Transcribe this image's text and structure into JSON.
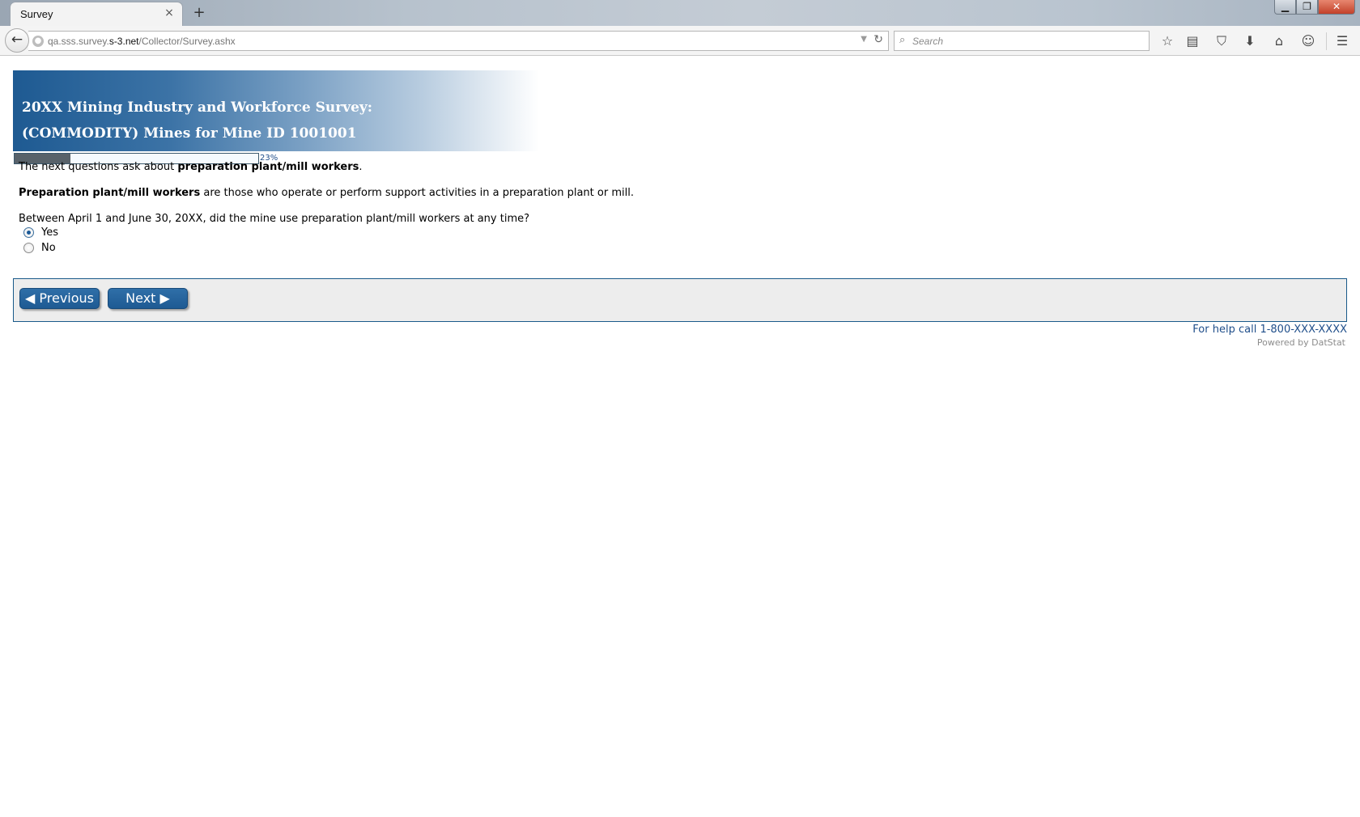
{
  "browser": {
    "tab_title": "Survey",
    "tab_close_glyph": "×",
    "new_tab_glyph": "+",
    "url_prefix": "qa.sss.survey.",
    "url_domain": "s-3.net",
    "url_path": "/Collector/Survey.ashx",
    "search_placeholder": "Search",
    "window_controls": {
      "minimize": "▁",
      "maximize": "❐",
      "close": "✕"
    },
    "toolbar_icons": [
      "star-icon",
      "reading-list-icon",
      "pocket-icon",
      "download-icon",
      "home-icon",
      "chat-icon",
      "menu-icon"
    ]
  },
  "survey": {
    "title_line1": "20XX Mining Industry and Workforce Survey:",
    "title_line2": "(COMMODITY) Mines for Mine ID 1001001",
    "progress_percent": 23,
    "progress_label": "23%",
    "intro": {
      "prefix": "The next questions ask about ",
      "bold": "preparation plant/mill workers",
      "suffix": "."
    },
    "definition": {
      "bold": "Preparation plant/mill workers",
      "rest": " are those who operate or perform support activities in a preparation plant or mill."
    },
    "question": "Between April 1 and June 30, 20XX, did the mine use preparation plant/mill workers at any time?",
    "options": [
      {
        "label": "Yes",
        "selected": true
      },
      {
        "label": "No",
        "selected": false
      }
    ],
    "prev_label": "◀ Previous",
    "next_label": "Next ▶",
    "help_text": "For help call 1-800-XXX-XXXX",
    "powered_by": "Powered by DatStat"
  },
  "colors": {
    "brand_blue": "#1e5a92",
    "progress_fill": "#58626a",
    "link_blue": "#1f4e8a",
    "panel_bg": "#ededed"
  }
}
